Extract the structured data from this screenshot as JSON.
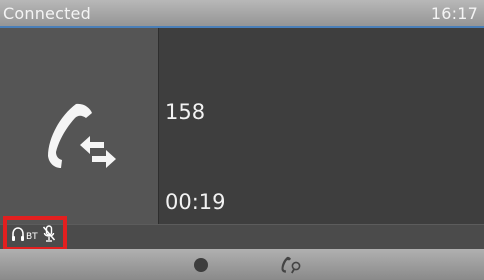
{
  "status_bar": {
    "title": "Connected",
    "time": "16:17"
  },
  "call": {
    "number": "158",
    "duration": "00:19"
  },
  "call_icon": {
    "name": "handset-transfer-icon"
  },
  "indicators": {
    "headset": {
      "icon": "headset-icon",
      "label": "BT"
    },
    "mic": {
      "icon": "mic-muted-icon"
    },
    "highlight_color": "#e21f1f"
  },
  "bottom_bar": {
    "home_icon": "home-dot-icon",
    "call_manager_icon": "handset-search-icon"
  }
}
